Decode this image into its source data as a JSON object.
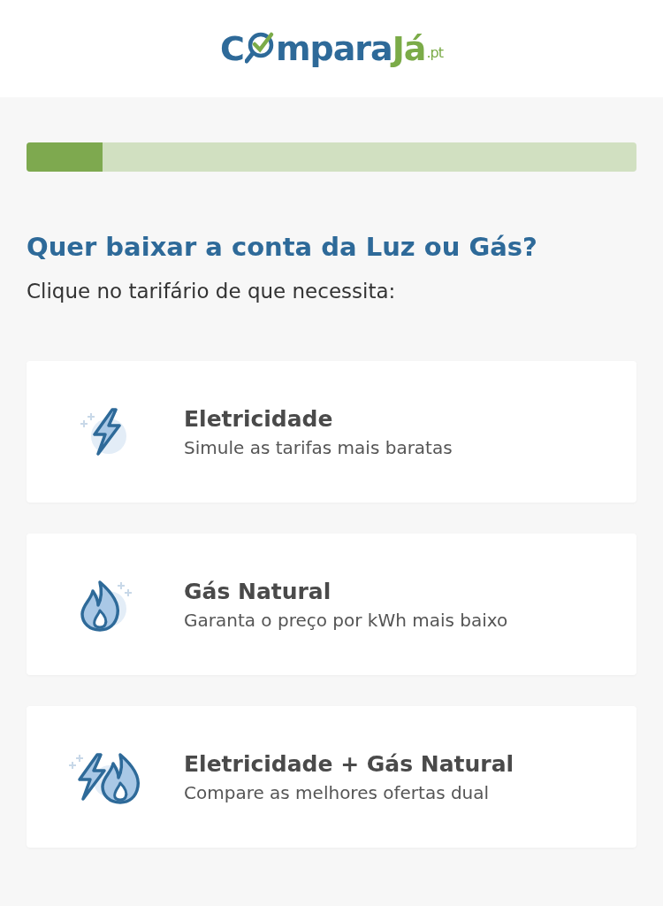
{
  "logo": {
    "first": "C",
    "rest": "mpara",
    "accent": "Já",
    "suffix": ".pt"
  },
  "progress": {
    "level": 0.125
  },
  "title": "Quer baixar a conta da Luz ou Gás?",
  "subtitle": "Clique no tarifário de que necessita:",
  "options": [
    {
      "kind": "electricity",
      "title": "Eletricidade",
      "description": "Simule as tarifas mais baratas"
    },
    {
      "kind": "gas",
      "title": "Gás Natural",
      "description": "Garanta o preço por kWh mais baixo"
    },
    {
      "kind": "dual",
      "title": "Eletricidade + Gás Natural",
      "description": "Compare as melhores ofertas dual"
    }
  ]
}
